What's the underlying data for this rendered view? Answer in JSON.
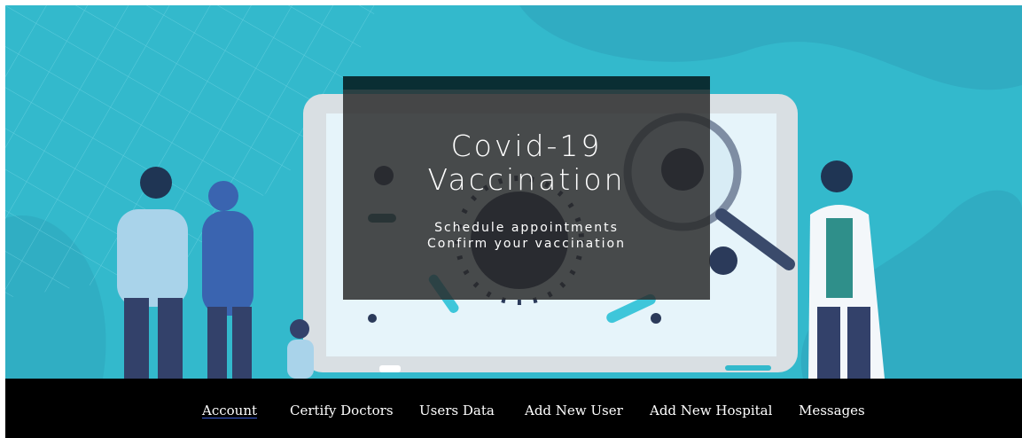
{
  "hero": {
    "title_line1": "Covid-19",
    "title_line2": "Vaccination",
    "subtitle_line1": "Schedule appointments",
    "subtitle_line2": "Confirm your vaccination"
  },
  "nav": {
    "items": [
      {
        "label": "Account",
        "active": true
      },
      {
        "label": "Certify Doctors",
        "active": false
      },
      {
        "label": "Users Data",
        "active": false
      },
      {
        "label": "Add New User",
        "active": false
      },
      {
        "label": "Add New Hospital",
        "active": false
      },
      {
        "label": "Messages",
        "active": false
      }
    ]
  },
  "colors": {
    "hero_bg": "#33b9cc",
    "nav_bg": "#000000",
    "overlay": "#2a2a2a",
    "active_underline": "#3a5bd1"
  }
}
